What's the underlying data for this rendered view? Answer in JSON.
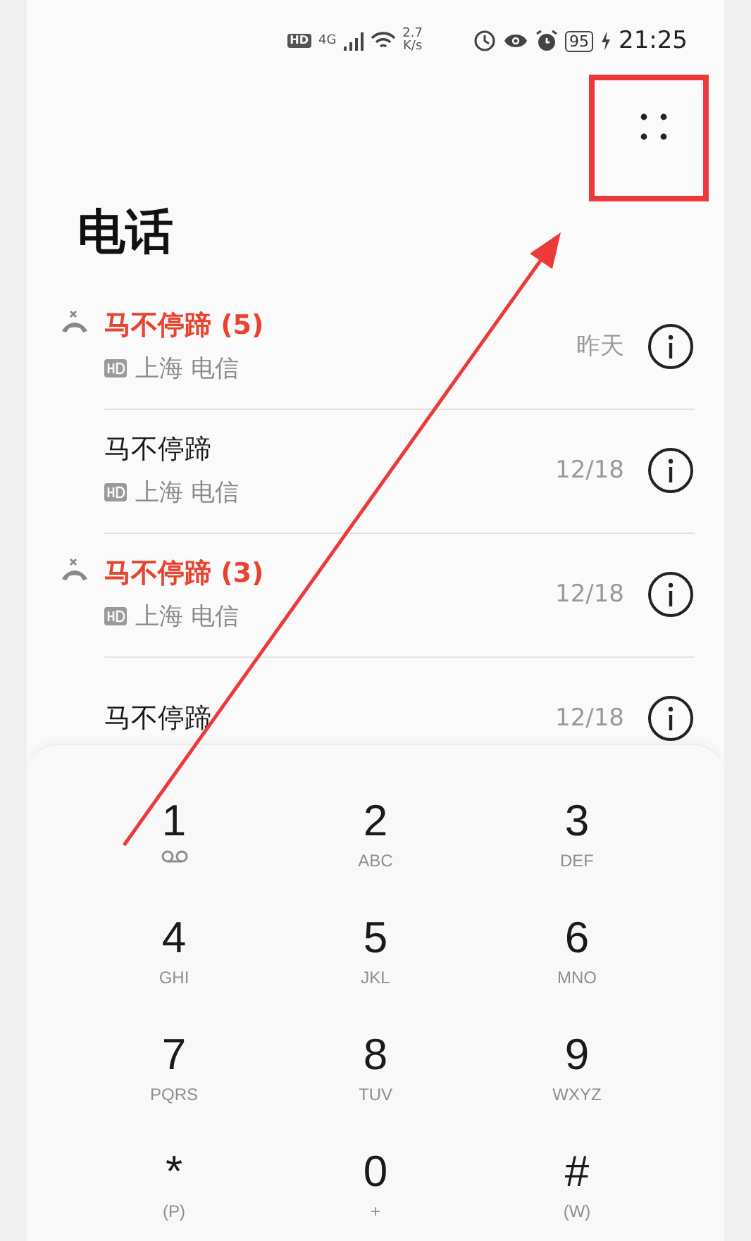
{
  "status_bar": {
    "hd": "HD",
    "network": "4G",
    "speed_value": "2.7",
    "speed_unit": "K/s",
    "battery": "95",
    "time": "21:25"
  },
  "title": "电话",
  "calls": [
    {
      "name": "马不停蹄 (5)",
      "missed": true,
      "location": "上海 电信",
      "date": "昨天"
    },
    {
      "name": "马不停蹄",
      "missed": false,
      "location": "上海 电信",
      "date": "12/18"
    },
    {
      "name": "马不停蹄 (3)",
      "missed": true,
      "location": "上海 电信",
      "date": "12/18"
    },
    {
      "name": "马不停蹄",
      "missed": false,
      "date": "12/18"
    }
  ],
  "keypad": [
    {
      "digit": "1",
      "kind": "voicemail"
    },
    {
      "digit": "2",
      "kind": "letters",
      "letters": "ABC"
    },
    {
      "digit": "3",
      "kind": "letters",
      "letters": "DEF"
    },
    {
      "digit": "4",
      "kind": "letters",
      "letters": "GHI"
    },
    {
      "digit": "5",
      "kind": "letters",
      "letters": "JKL"
    },
    {
      "digit": "6",
      "kind": "letters",
      "letters": "MNO"
    },
    {
      "digit": "7",
      "kind": "letters",
      "letters": "PQRS"
    },
    {
      "digit": "8",
      "kind": "letters",
      "letters": "TUV"
    },
    {
      "digit": "9",
      "kind": "letters",
      "letters": "WXYZ"
    },
    {
      "digit": "*",
      "kind": "letters",
      "letters": "(P)"
    },
    {
      "digit": "0",
      "kind": "letters",
      "letters": "+"
    },
    {
      "digit": "#",
      "kind": "letters",
      "letters": "(W)"
    }
  ]
}
